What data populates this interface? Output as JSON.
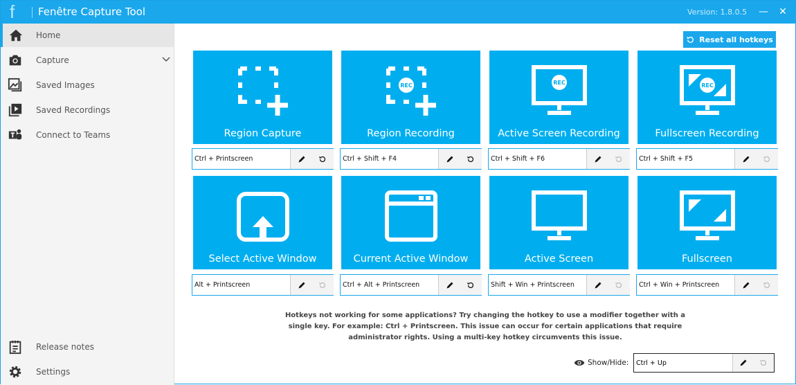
{
  "window": {
    "title": "Fenêtre Capture Tool",
    "logo": "f",
    "version": "Version: 1.8.0.5"
  },
  "sidebar": {
    "items": [
      {
        "label": "Home",
        "icon": "home-icon"
      },
      {
        "label": "Capture",
        "icon": "camera-icon"
      },
      {
        "label": "Saved Images",
        "icon": "images-icon"
      },
      {
        "label": "Saved Recordings",
        "icon": "recordings-icon"
      },
      {
        "label": "Connect to Teams",
        "icon": "teams-icon"
      }
    ],
    "bottom": [
      {
        "label": "Release notes",
        "icon": "notes-icon"
      },
      {
        "label": "Settings",
        "icon": "gear-icon"
      }
    ]
  },
  "toolbar": {
    "reset_all": "Reset all hotkeys"
  },
  "tiles": [
    {
      "label": "Region Capture",
      "hotkey": "Ctrl + Printscreen",
      "reset_enabled": true
    },
    {
      "label": "Region Recording",
      "hotkey": "Ctrl + Shift + F4",
      "reset_enabled": true
    },
    {
      "label": "Active Screen Recording",
      "hotkey": "Ctrl + Shift + F6",
      "reset_enabled": false
    },
    {
      "label": "Fullscreen Recording",
      "hotkey": "Ctrl + Shift + F5",
      "reset_enabled": false
    },
    {
      "label": "Select Active Window",
      "hotkey": "Alt + Printscreen",
      "reset_enabled": false
    },
    {
      "label": "Current Active Window",
      "hotkey": "Ctrl + Alt + Printscreen",
      "reset_enabled": true
    },
    {
      "label": "Active Screen",
      "hotkey": "Shift + Win + Printscreen",
      "reset_enabled": false
    },
    {
      "label": "Fullscreen",
      "hotkey": "Ctrl + Win + Printscreen",
      "reset_enabled": false
    }
  ],
  "rec_badge": "REC",
  "notice": "Hotkeys not working for some applications? Try changing the hotkey to use a modifier together with a single key. For example: Ctrl + Printscreen. This issue can occur for certain applications that require administrator rights. Using a multi-key hotkey circumvents this issue.",
  "showhide": {
    "label": "Show/Hide:",
    "hotkey": "Ctrl + Up"
  },
  "colors": {
    "accent": "#1aa7ec",
    "tile": "#00aeef"
  }
}
